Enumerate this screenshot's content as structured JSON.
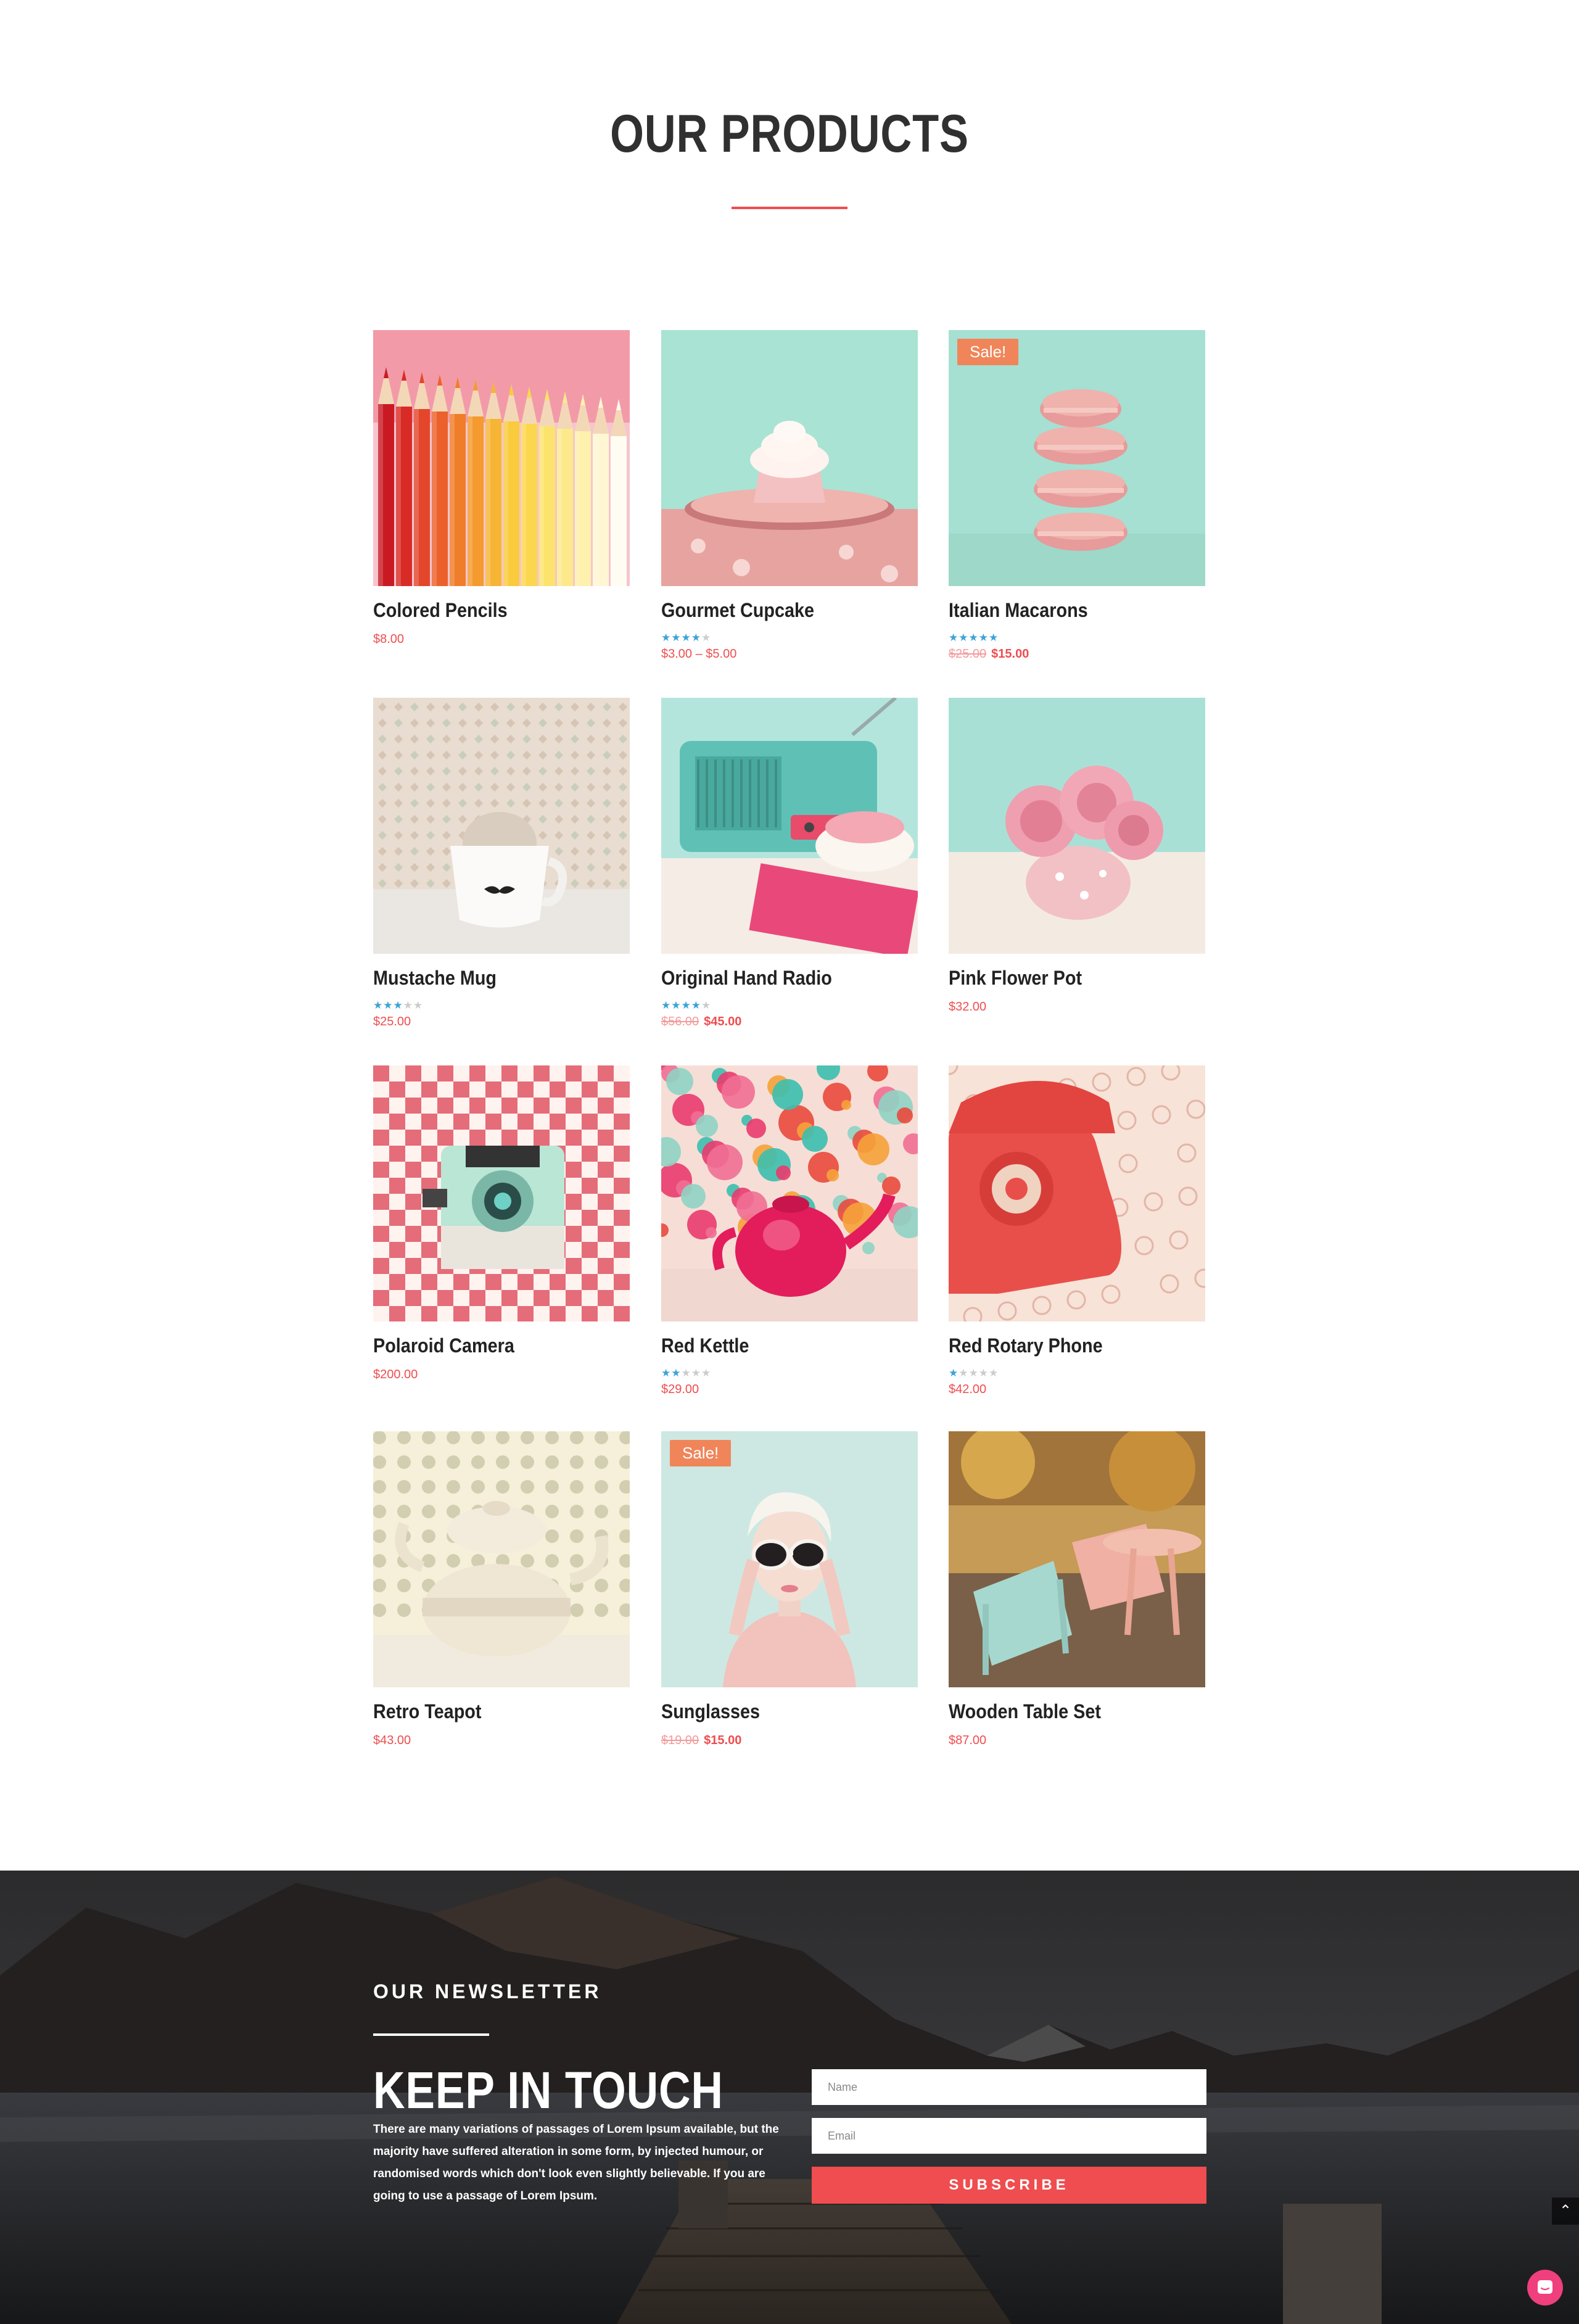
{
  "section": {
    "title": "OUR PRODUCTS",
    "accent_color": "#ef4d4f"
  },
  "products": [
    {
      "name": "Colored Pencils",
      "price": "$8.00",
      "rating": 0,
      "sale": false,
      "image": "colored-pencils"
    },
    {
      "name": "Gourmet Cupcake",
      "price": "$3.00 – $5.00",
      "rating": 4,
      "sale": false,
      "image": "cupcake"
    },
    {
      "name": "Italian Macarons",
      "old_price": "$25.00",
      "price": "$15.00",
      "rating": 5,
      "sale": true,
      "badge": "Sale!",
      "image": "macarons"
    },
    {
      "name": "Mustache Mug",
      "price": "$25.00",
      "rating": 3,
      "sale": false,
      "image": "mug"
    },
    {
      "name": "Original Hand Radio",
      "old_price": "$56.00",
      "price": "$45.00",
      "rating": 4,
      "sale": true,
      "image": "radio"
    },
    {
      "name": "Pink Flower Pot",
      "price": "$32.00",
      "rating": 0,
      "sale": false,
      "image": "flower-pot"
    },
    {
      "name": "Polaroid Camera",
      "price": "$200.00",
      "rating": 0,
      "sale": false,
      "image": "camera"
    },
    {
      "name": "Red Kettle",
      "price": "$29.00",
      "rating": 2,
      "sale": false,
      "image": "kettle"
    },
    {
      "name": "Red Rotary Phone",
      "price": "$42.00",
      "rating": 1,
      "sale": false,
      "image": "phone"
    },
    {
      "name": "Retro Teapot",
      "price": "$43.00",
      "rating": 0,
      "sale": false,
      "image": "teapot"
    },
    {
      "name": "Sunglasses",
      "old_price": "$19.00",
      "price": "$15.00",
      "rating": 0,
      "sale": true,
      "badge": "Sale!",
      "image": "sunglasses"
    },
    {
      "name": "Wooden Table Set",
      "price": "$87.00",
      "rating": 0,
      "sale": false,
      "image": "table-set"
    }
  ],
  "newsletter": {
    "kicker": "OUR NEWSLETTER",
    "title": "KEEP IN TOUCH",
    "text": "There are many variations of passages of Lorem Ipsum available, but the majority have suffered alteration in some form, by injected humour, or randomised words which don't look even slightly believable. If you are going to use a passage of Lorem Ipsum.",
    "name_placeholder": "Name",
    "email_placeholder": "Email",
    "button": "SUBSCRIBE"
  },
  "icons": {
    "back_to_top": "chevron-up-icon",
    "chat": "chat-icon"
  }
}
